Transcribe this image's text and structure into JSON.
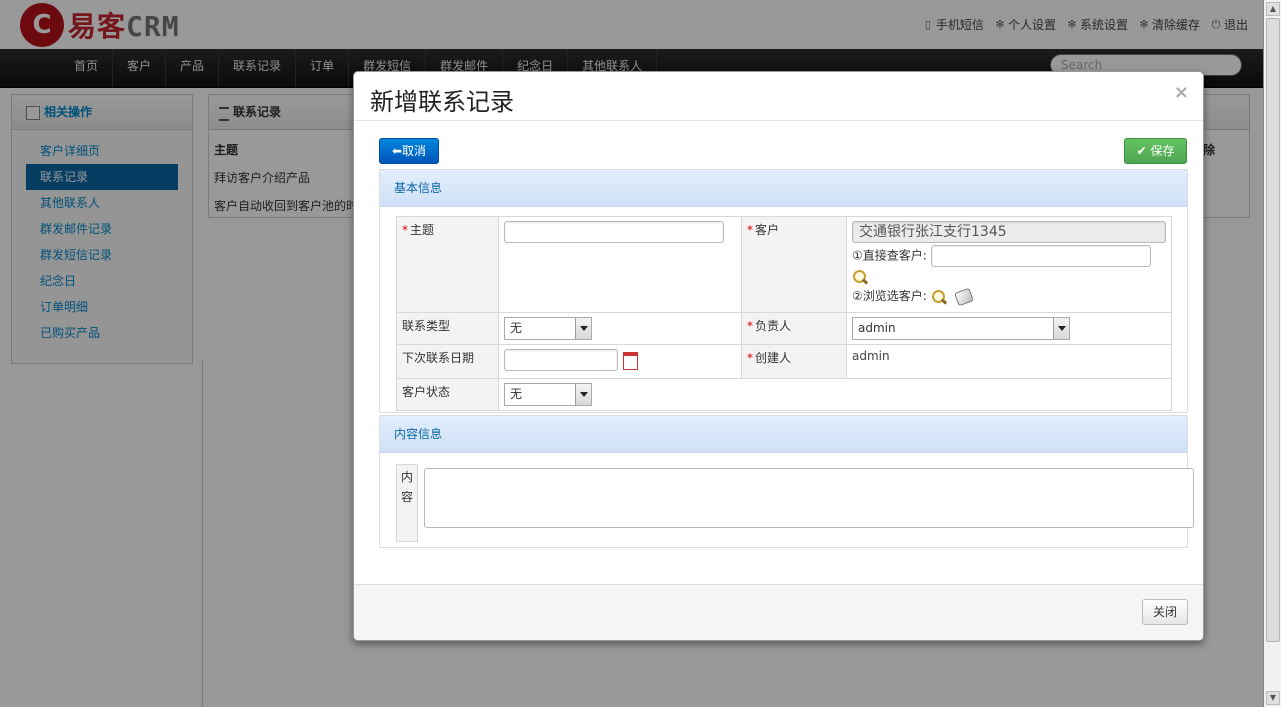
{
  "header": {
    "logo_text": "易客",
    "logo_crm": "CRM",
    "links": [
      {
        "icon": "phone-icon",
        "label": "手机短信"
      },
      {
        "icon": "gear-icon",
        "label": "个人设置"
      },
      {
        "icon": "gear-icon",
        "label": "系统设置"
      },
      {
        "icon": "gear-icon",
        "label": "清除缓存"
      },
      {
        "icon": "power-icon",
        "label": "退出"
      }
    ]
  },
  "nav": {
    "items": [
      "首页",
      "客户",
      "产品",
      "联系记录",
      "订单",
      "群发短信",
      "群发邮件",
      "纪念日",
      "其他联系人"
    ],
    "search_placeholder": "Search"
  },
  "sidebar": {
    "title": "相关操作",
    "items": [
      "客户详细页",
      "联系记录",
      "其他联系人",
      "群发邮件记录",
      "群发短信记录",
      "纪念日",
      "订单明细",
      "已购买产品"
    ],
    "active_index": 1
  },
  "main": {
    "title": "联系记录",
    "column_subject": "主题",
    "column_right": "除",
    "rows": [
      "拜访客户介绍产品",
      "客户自动收回到客户池的时"
    ]
  },
  "modal": {
    "title": "新增联系记录",
    "close_symbol": "×",
    "cancel_label": "取消",
    "save_label": "保存",
    "section_basic": "基本信息",
    "section_content": "内容信息",
    "fields": {
      "subject_label": "主题",
      "subject_value": "",
      "customer_label": "客户",
      "customer_value": "交通银行张江支行1345",
      "direct_lookup_label": "①直接查客户:",
      "browse_label": "②浏览选客户:",
      "contact_type_label": "联系类型",
      "contact_type_value": "无",
      "owner_label": "负责人",
      "owner_value": "admin",
      "next_date_label": "下次联系日期",
      "creator_label": "创建人",
      "creator_value": "admin",
      "status_label": "客户状态",
      "status_value": "无",
      "required_mark": "*"
    },
    "content_label_1": "内",
    "content_label_2": "容",
    "footer_close": "关闭"
  },
  "colors": {
    "accent_blue": "#0a67a6",
    "save_green": "#51a351",
    "cancel_blue": "#0055bb",
    "required_red": "#dd0000"
  }
}
